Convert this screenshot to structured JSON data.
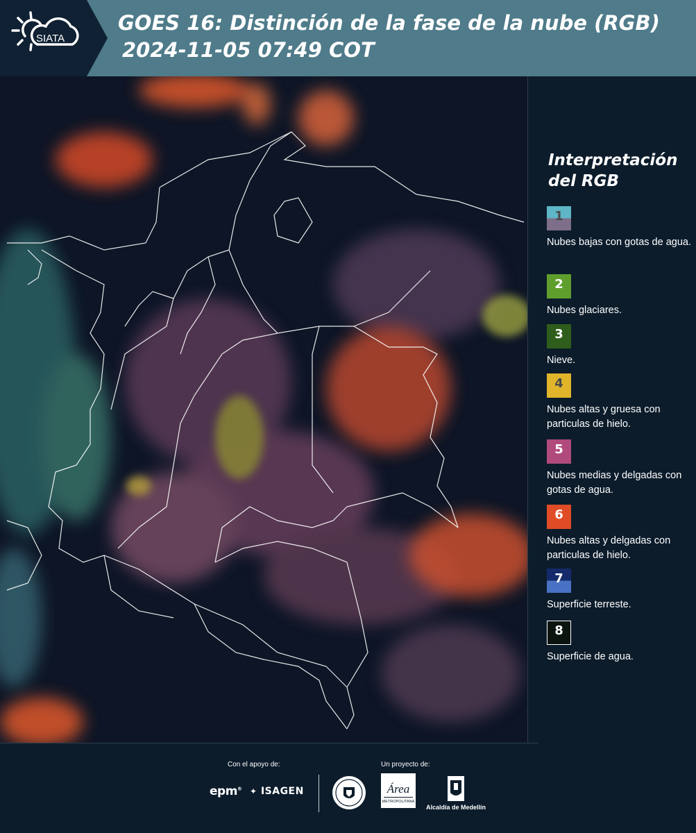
{
  "header": {
    "logo_text": "SIATA",
    "title_line1": "GOES 16: Distinción de la fase de la nube (RGB)",
    "title_line2": "2024-11-05 07:49 COT"
  },
  "legend": {
    "title": "Interpretación del RGB",
    "items": [
      {
        "num": "1",
        "label": "Nubes bajas con gotas de agua.",
        "color_top": "#5fb6c6",
        "color_bottom": "#7d6e8a",
        "num_color": "#4a4a4a"
      },
      {
        "num": "2",
        "label": "Nubes glaciares.",
        "color_top": "#5f9e2d",
        "num_color": "#ffffff"
      },
      {
        "num": "3",
        "label": "Nieve.",
        "color_top": "#2f5d1c",
        "num_color": "#ffffff"
      },
      {
        "num": "4",
        "label": "Nubes altas y gruesa con particulas de hielo.",
        "color_top": "#e0b52a",
        "num_color": "#4a4a4a"
      },
      {
        "num": "5",
        "label": "Nubes medias y delgadas con gotas de agua.",
        "color_top": "#b04a7c",
        "num_color": "#ffffff"
      },
      {
        "num": "6",
        "label": "Nubes altas y delgadas con particulas de hielo.",
        "color_top": "#e04c25",
        "num_color": "#ffffff"
      },
      {
        "num": "7",
        "label": "Superficie terreste.",
        "color_top": "#142a6a",
        "color_bottom": "#4a72c4",
        "num_color": "#ffffff"
      },
      {
        "num": "8",
        "label": "Superficie de agua.",
        "color_top": "#0c1410",
        "num_color": "#ffffff",
        "border": "#ffffff"
      }
    ]
  },
  "footer": {
    "support_label": "Con el apoyo de:",
    "project_label": "Un proyecto de:",
    "sponsors": [
      "epm",
      "ISAGEN"
    ],
    "partners": [
      "Área Metropolitana Valle de Aburrá",
      "Alcaldía de Medellín"
    ]
  }
}
